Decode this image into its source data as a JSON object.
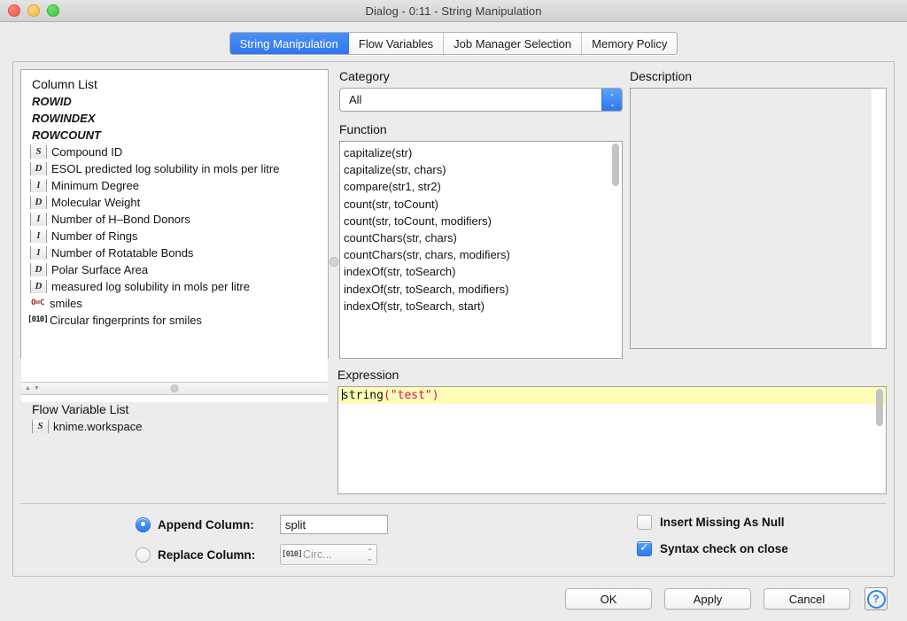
{
  "window": {
    "title": "Dialog - 0:11 - String Manipulation",
    "traffic_lights": [
      "close",
      "minimize",
      "zoom"
    ]
  },
  "tabs": [
    {
      "label": "String Manipulation",
      "active": true
    },
    {
      "label": "Flow Variables",
      "active": false
    },
    {
      "label": "Job Manager Selection",
      "active": false
    },
    {
      "label": "Memory Policy",
      "active": false
    }
  ],
  "column_list": {
    "heading": "Column List",
    "items": [
      {
        "label": "ROWID",
        "icon": "",
        "kind": "rowvar"
      },
      {
        "label": "ROWINDEX",
        "icon": "",
        "kind": "rowvar"
      },
      {
        "label": "ROWCOUNT",
        "icon": "",
        "kind": "rowvar"
      },
      {
        "label": "Compound ID",
        "icon": "S",
        "kind": "string"
      },
      {
        "label": "ESOL predicted log solubility in mols per litre",
        "icon": "D",
        "kind": "double"
      },
      {
        "label": "Minimum Degree",
        "icon": "I",
        "kind": "int"
      },
      {
        "label": "Molecular Weight",
        "icon": "D",
        "kind": "double"
      },
      {
        "label": "Number of H–Bond Donors",
        "icon": "I",
        "kind": "int"
      },
      {
        "label": "Number of Rings",
        "icon": "I",
        "kind": "int"
      },
      {
        "label": "Number of Rotatable Bonds",
        "icon": "I",
        "kind": "int"
      },
      {
        "label": "Polar Surface Area",
        "icon": "D",
        "kind": "double"
      },
      {
        "label": "measured log solubility in mols per litre",
        "icon": "D",
        "kind": "double"
      },
      {
        "label": "smiles",
        "icon": "O=C",
        "kind": "smiles"
      },
      {
        "label": "Circular fingerprints for smiles",
        "icon": "[010]",
        "kind": "fingerprint"
      }
    ]
  },
  "flow_variable_list": {
    "heading": "Flow Variable List",
    "items": [
      {
        "label": "knime.workspace",
        "icon": "S",
        "kind": "string"
      }
    ]
  },
  "category": {
    "label": "Category",
    "value": "All"
  },
  "function": {
    "label": "Function",
    "items": [
      "capitalize(str)",
      "capitalize(str, chars)",
      "compare(str1, str2)",
      "count(str, toCount)",
      "count(str, toCount, modifiers)",
      "countChars(str, chars)",
      "countChars(str, chars, modifiers)",
      "indexOf(str, toSearch)",
      "indexOf(str, toSearch, modifiers)",
      "indexOf(str, toSearch, start)"
    ]
  },
  "description": {
    "label": "Description",
    "content": ""
  },
  "expression": {
    "label": "Expression",
    "text": "string(\"test\")",
    "tokens": {
      "function_name": "string",
      "argument": "(\"test\")"
    }
  },
  "options": {
    "append": {
      "label": "Append Column:",
      "selected": true,
      "value": "split",
      "placeholder": ""
    },
    "replace": {
      "label": "Replace Column:",
      "selected": false,
      "value": "Circ...",
      "icon": "[010]"
    },
    "insert_missing_as_null": {
      "label": "Insert Missing As Null",
      "checked": false
    },
    "syntax_check_on_close": {
      "label": "Syntax check on close",
      "checked": true
    }
  },
  "footer": {
    "ok": "OK",
    "apply": "Apply",
    "cancel": "Cancel",
    "help": "?"
  },
  "colors": {
    "accent_blue": "#2f76ec",
    "expr_highlight": "#fdfdb8",
    "expr_string": "#e0115f",
    "window_bg": "#ececec",
    "smiles_icon": "#9e1b1b"
  }
}
